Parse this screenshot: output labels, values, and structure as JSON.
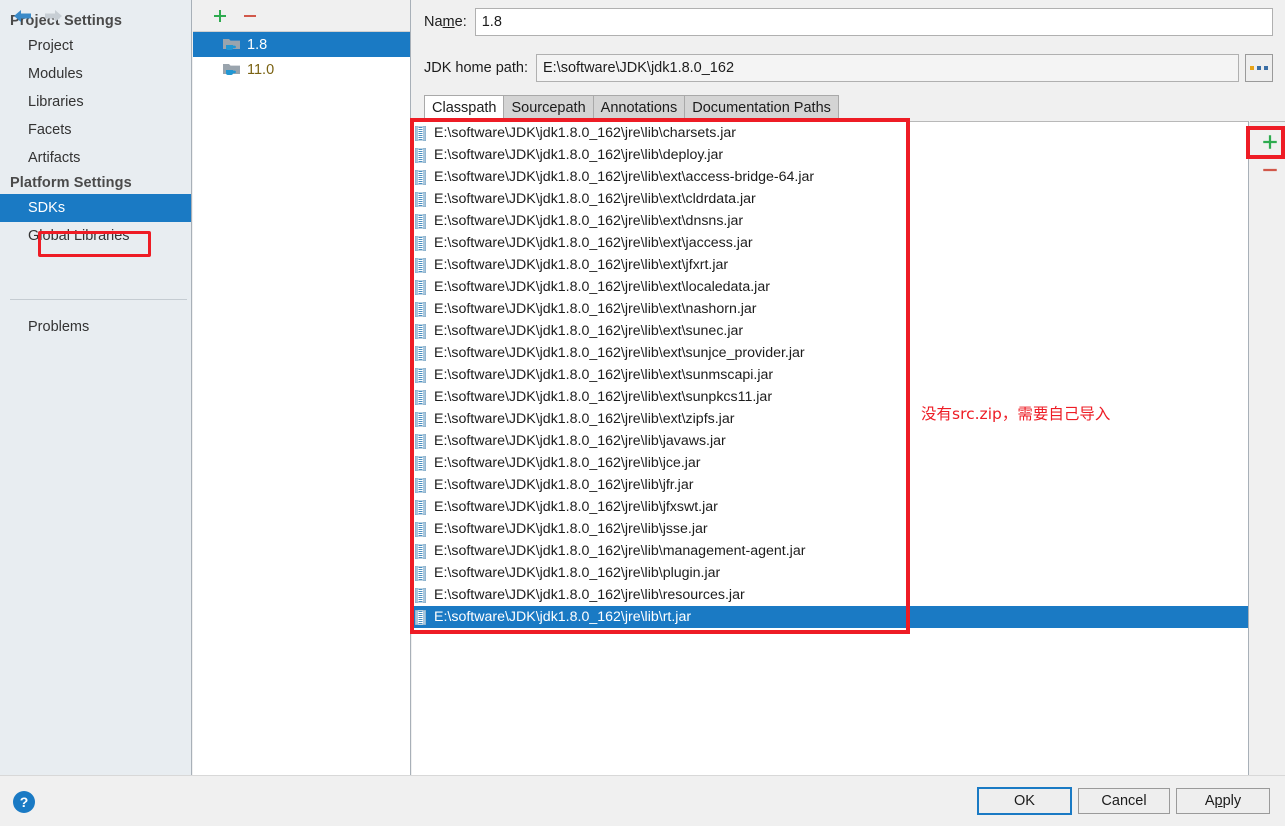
{
  "colors": {
    "selection_blue": "#1a7ac4",
    "annotation_red": "#ee1c25",
    "sidebar_bg": "#e8edf1",
    "panel_bg": "#f0f0f0",
    "olive_text": "#7a6212"
  },
  "nav": {
    "back_icon": "arrow-left-icon",
    "forward_icon": "arrow-right-icon"
  },
  "sidebar": {
    "groups": [
      {
        "title": "Project Settings",
        "items": [
          {
            "label": "Project",
            "selected": false
          },
          {
            "label": "Modules",
            "selected": false
          },
          {
            "label": "Libraries",
            "selected": false
          },
          {
            "label": "Facets",
            "selected": false
          },
          {
            "label": "Artifacts",
            "selected": false
          }
        ]
      },
      {
        "title": "Platform Settings",
        "items": [
          {
            "label": "SDKs",
            "selected": true
          },
          {
            "label": "Global Libraries",
            "selected": false
          }
        ]
      }
    ],
    "problems": {
      "label": "Problems"
    }
  },
  "sdk_panel": {
    "toolbar": {
      "add_label": "+",
      "remove_label": "−"
    },
    "items": [
      {
        "label": "1.8",
        "selected": true
      },
      {
        "label": "11.0",
        "selected": false
      }
    ]
  },
  "details": {
    "name_label_pre": "Na",
    "name_label_mnemonic": "m",
    "name_label_post": "e:",
    "name_value": "1.8",
    "jdk_home_label": "JDK home path:",
    "jdk_home_value": "E:\\software\\JDK\\jdk1.8.0_162",
    "browse_label": "browse-ellipsis"
  },
  "tabs": [
    {
      "label": "Classpath",
      "active": true
    },
    {
      "label": "Sourcepath",
      "active": false
    },
    {
      "label": "Annotations",
      "active": false
    },
    {
      "label": "Documentation Paths",
      "active": false
    }
  ],
  "classpath": {
    "side_buttons": {
      "add_label": "+",
      "remove_label": "−"
    },
    "entries": [
      {
        "path": "E:\\software\\JDK\\jdk1.8.0_162\\jre\\lib\\charsets.jar",
        "selected": false
      },
      {
        "path": "E:\\software\\JDK\\jdk1.8.0_162\\jre\\lib\\deploy.jar",
        "selected": false
      },
      {
        "path": "E:\\software\\JDK\\jdk1.8.0_162\\jre\\lib\\ext\\access-bridge-64.jar",
        "selected": false
      },
      {
        "path": "E:\\software\\JDK\\jdk1.8.0_162\\jre\\lib\\ext\\cldrdata.jar",
        "selected": false
      },
      {
        "path": "E:\\software\\JDK\\jdk1.8.0_162\\jre\\lib\\ext\\dnsns.jar",
        "selected": false
      },
      {
        "path": "E:\\software\\JDK\\jdk1.8.0_162\\jre\\lib\\ext\\jaccess.jar",
        "selected": false
      },
      {
        "path": "E:\\software\\JDK\\jdk1.8.0_162\\jre\\lib\\ext\\jfxrt.jar",
        "selected": false
      },
      {
        "path": "E:\\software\\JDK\\jdk1.8.0_162\\jre\\lib\\ext\\localedata.jar",
        "selected": false
      },
      {
        "path": "E:\\software\\JDK\\jdk1.8.0_162\\jre\\lib\\ext\\nashorn.jar",
        "selected": false
      },
      {
        "path": "E:\\software\\JDK\\jdk1.8.0_162\\jre\\lib\\ext\\sunec.jar",
        "selected": false
      },
      {
        "path": "E:\\software\\JDK\\jdk1.8.0_162\\jre\\lib\\ext\\sunjce_provider.jar",
        "selected": false
      },
      {
        "path": "E:\\software\\JDK\\jdk1.8.0_162\\jre\\lib\\ext\\sunmscapi.jar",
        "selected": false
      },
      {
        "path": "E:\\software\\JDK\\jdk1.8.0_162\\jre\\lib\\ext\\sunpkcs11.jar",
        "selected": false
      },
      {
        "path": "E:\\software\\JDK\\jdk1.8.0_162\\jre\\lib\\ext\\zipfs.jar",
        "selected": false
      },
      {
        "path": "E:\\software\\JDK\\jdk1.8.0_162\\jre\\lib\\javaws.jar",
        "selected": false
      },
      {
        "path": "E:\\software\\JDK\\jdk1.8.0_162\\jre\\lib\\jce.jar",
        "selected": false
      },
      {
        "path": "E:\\software\\JDK\\jdk1.8.0_162\\jre\\lib\\jfr.jar",
        "selected": false
      },
      {
        "path": "E:\\software\\JDK\\jdk1.8.0_162\\jre\\lib\\jfxswt.jar",
        "selected": false
      },
      {
        "path": "E:\\software\\JDK\\jdk1.8.0_162\\jre\\lib\\jsse.jar",
        "selected": false
      },
      {
        "path": "E:\\software\\JDK\\jdk1.8.0_162\\jre\\lib\\management-agent.jar",
        "selected": false
      },
      {
        "path": "E:\\software\\JDK\\jdk1.8.0_162\\jre\\lib\\plugin.jar",
        "selected": false
      },
      {
        "path": "E:\\software\\JDK\\jdk1.8.0_162\\jre\\lib\\resources.jar",
        "selected": false
      },
      {
        "path": "E:\\software\\JDK\\jdk1.8.0_162\\jre\\lib\\rt.jar",
        "selected": true
      }
    ]
  },
  "annotation": {
    "note_text": "没有src.zip，需要自己导入"
  },
  "footer": {
    "help_label": "?",
    "ok_label": "OK",
    "cancel_label": "Cancel",
    "apply_pre": "A",
    "apply_mnemonic": "p",
    "apply_post": "ply"
  }
}
